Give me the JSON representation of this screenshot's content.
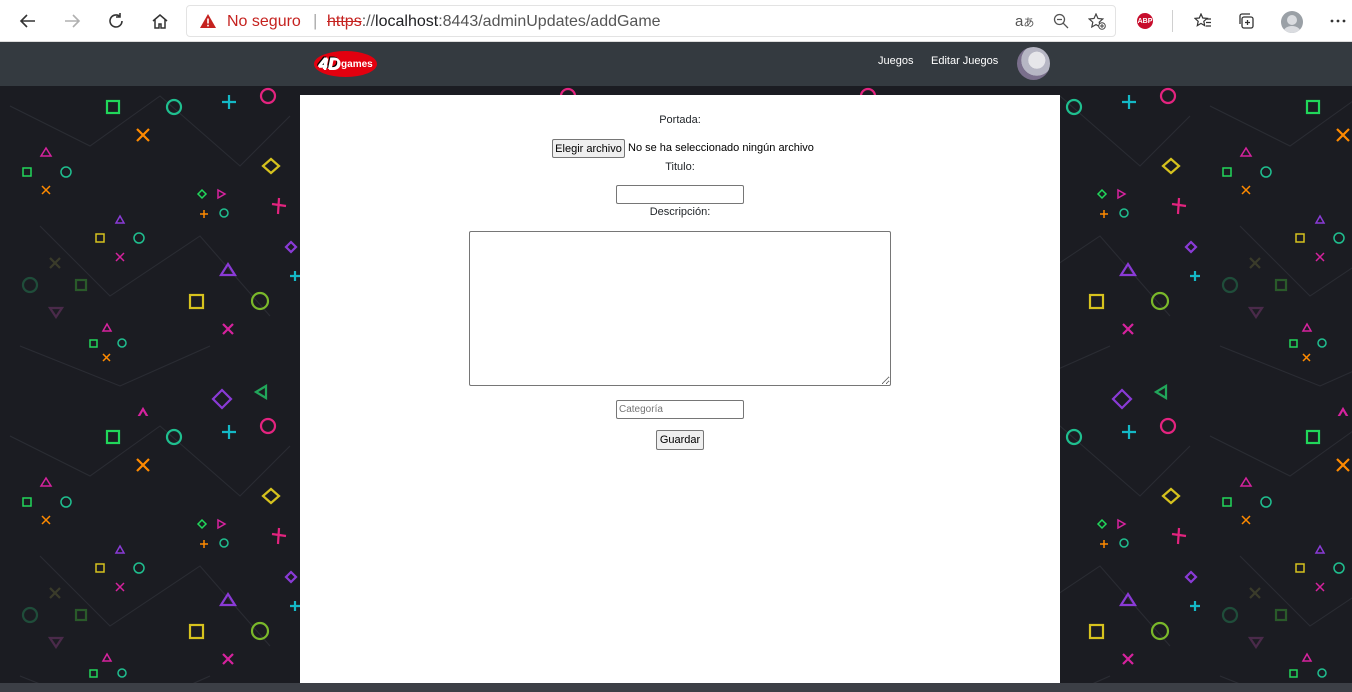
{
  "browser": {
    "security_text": "No seguro",
    "url_scheme": "https",
    "url_rest": "://",
    "url_host": "localhost",
    "url_path": ":8443/adminUpdates/addGame",
    "toolbar_icons": [
      "back-arrow",
      "forward-arrow",
      "reload",
      "home",
      "read-aloud",
      "zoom",
      "add-favorite",
      "adblock-plus",
      "favorites",
      "collections",
      "profile",
      "more"
    ],
    "abp_label": "ABP"
  },
  "navbar": {
    "logo_four": "4",
    "logo_d": "D",
    "logo_games": "games",
    "links": [
      {
        "label": "Juegos"
      },
      {
        "label": "Editar Juegos"
      }
    ],
    "bg_color": "#343a40"
  },
  "form": {
    "cover_label": "Portada:",
    "file_button": "Elegir archivo",
    "file_status": "No se ha seleccionado ningún archivo",
    "title_label": "Titulo:",
    "title_value": "",
    "description_label": "Descripción:",
    "description_value": "",
    "category_placeholder": "Categoría",
    "save_button": "Guardar"
  },
  "colors": {
    "page_bg": "#1b1c22",
    "warning_red": "#c5221f",
    "logo_red": "#e3000f"
  }
}
